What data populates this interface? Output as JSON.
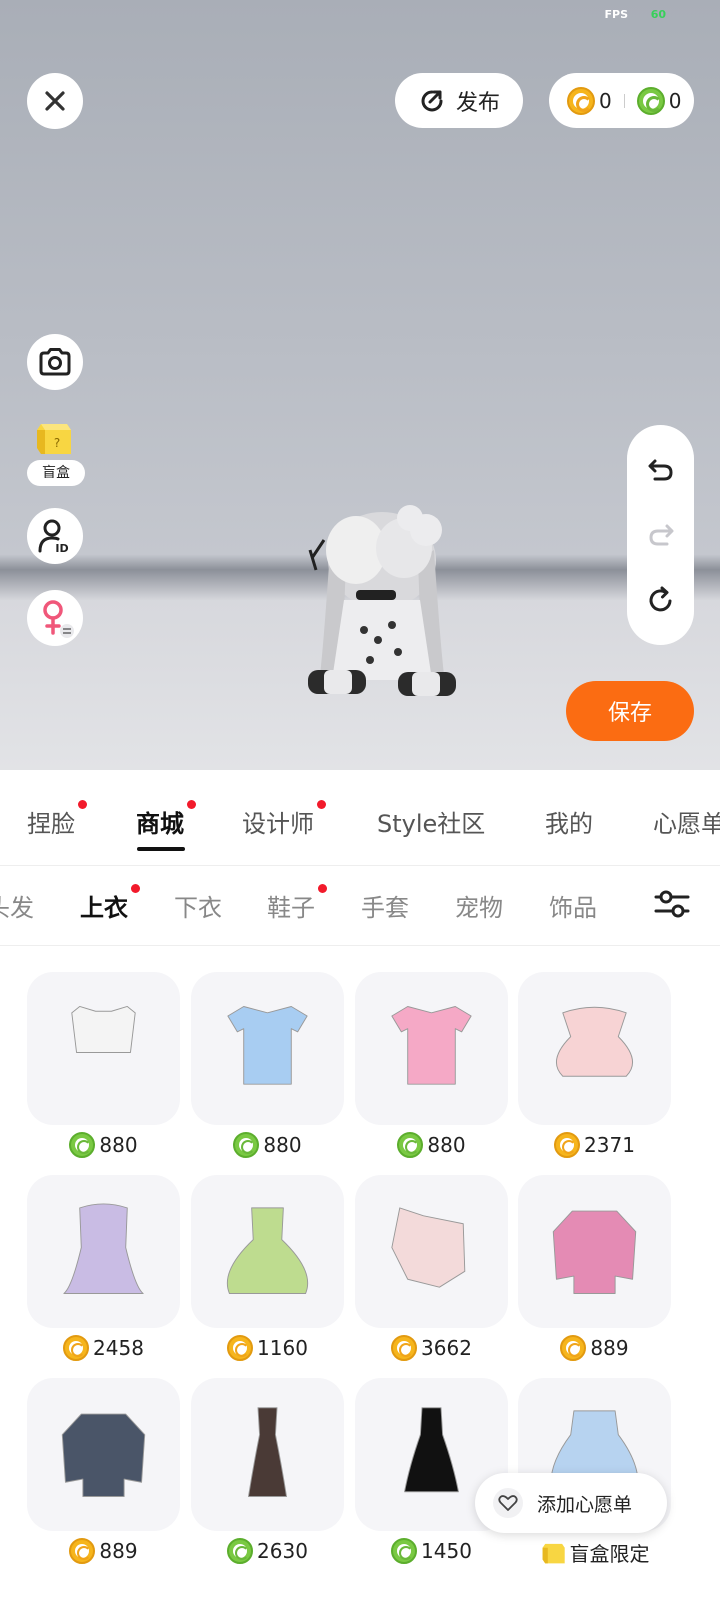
{
  "status": {
    "fps_label": "FPS",
    "fps_value": "60"
  },
  "top_bar": {
    "publish_label": "发布",
    "gold_balance": "0",
    "green_balance": "0"
  },
  "side_tools": {
    "blindbox_label": "盲盒",
    "icons": [
      "camera-icon",
      "blindbox-icon",
      "id-card-icon",
      "female-icon"
    ]
  },
  "history": {
    "icons": [
      "undo-icon",
      "redo-icon",
      "reset-icon"
    ]
  },
  "save_label": "保存",
  "main_tabs": [
    {
      "label": "捏脸",
      "dot": true
    },
    {
      "label": "商城",
      "dot": true,
      "active": true
    },
    {
      "label": "设计师",
      "dot": true
    },
    {
      "label": "Style社区",
      "dot": false
    },
    {
      "label": "我的",
      "dot": false
    },
    {
      "label": "心愿单",
      "dot": false
    }
  ],
  "sub_tabs": [
    {
      "label": "头发",
      "dot": false
    },
    {
      "label": "上衣",
      "dot": true,
      "active": true
    },
    {
      "label": "下衣",
      "dot": false
    },
    {
      "label": "鞋子",
      "dot": true
    },
    {
      "label": "手套",
      "dot": false
    },
    {
      "label": "宠物",
      "dot": false
    },
    {
      "label": "饰品",
      "dot": false
    }
  ],
  "items": [
    {
      "name": "white-corset-top",
      "currency": "green",
      "price": "880",
      "color": "#f4f4f4"
    },
    {
      "name": "blue-bow-shirt",
      "currency": "green",
      "price": "880",
      "color": "#a8cdf2"
    },
    {
      "name": "pink-bow-shirt",
      "currency": "green",
      "price": "880",
      "color": "#f5a9c6"
    },
    {
      "name": "pink-ruffle-dress",
      "currency": "gold",
      "price": "2371",
      "color": "#f7d3d4"
    },
    {
      "name": "lavender-robe",
      "currency": "gold",
      "price": "2458",
      "color": "#c9bce4"
    },
    {
      "name": "green-princess-gown",
      "currency": "gold",
      "price": "1160",
      "color": "#bedc8f"
    },
    {
      "name": "white-lace-dress",
      "currency": "gold",
      "price": "3662",
      "color": "#f3dada"
    },
    {
      "name": "pink-sweater",
      "currency": "gold",
      "price": "889",
      "color": "#e48bb4"
    },
    {
      "name": "grey-sweater",
      "currency": "gold",
      "price": "889",
      "color": "#4a5568"
    },
    {
      "name": "brown-long-dress",
      "currency": "green",
      "price": "2630",
      "color": "#4a3a36"
    },
    {
      "name": "black-halter-dress",
      "currency": "green",
      "price": "1450",
      "color": "#111111"
    },
    {
      "name": "blue-bird-gown",
      "currency": "blindbox",
      "price": "盲盒限定",
      "color": "#b7d3f0"
    }
  ],
  "wishlist_button": "添加心愿单"
}
